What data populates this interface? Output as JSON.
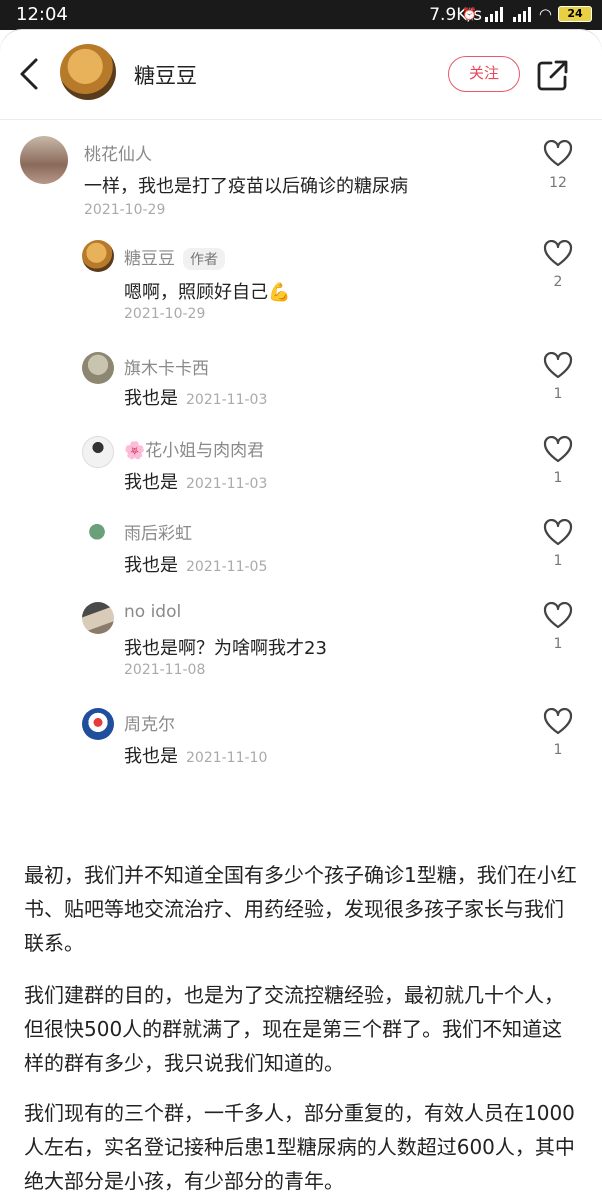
{
  "status_bar": {
    "time": "12:04",
    "speed": "7.9K/s",
    "battery": "24"
  },
  "header": {
    "title": "糖豆豆",
    "follow_label": "关注"
  },
  "comments": [
    {
      "name": "桃花仙人",
      "text": "一样，我也是打了疫苗以后确诊的糖尿病",
      "date": "2021-10-29",
      "likes": "12"
    },
    {
      "name": "糖豆豆",
      "tag": "作者",
      "text": "嗯啊，照顾好自己💪",
      "date": "2021-10-29",
      "likes": "2"
    },
    {
      "name": "旗木卡卡西",
      "text": "我也是",
      "date": "2021-11-03",
      "likes": "1"
    },
    {
      "name": "🌸花小姐与肉肉君",
      "text": "我也是",
      "date": "2021-11-03",
      "likes": "1"
    },
    {
      "name": "雨后彩虹",
      "text": "我也是",
      "date": "2021-11-05",
      "likes": "1"
    },
    {
      "name": "no idol",
      "text": "我也是啊？为啥啊我才23",
      "date": "2021-11-08",
      "likes": "1"
    },
    {
      "name": "周克尔",
      "text": "我也是",
      "date": "2021-11-10",
      "likes": "1"
    }
  ],
  "article": {
    "paragraphs": [
      "最初，我们并不知道全国有多少个孩子确诊1型糖，我们在小红书、贴吧等地交流治疗、用药经验，发现很多孩子家长与我们联系。",
      "我们建群的目的，也是为了交流控糖经验，最初就几十个人，但很快500人的群就满了，现在是第三个群了。我们不知道这样的群有多少，我只说我们知道的。",
      "我们现有的三个群，一千多人，部分重复的，有效人员在1000人左右，实名登记接种后患1型糖尿病的人数超过600人，其中绝大部分是小孩，有少部分的青年。"
    ]
  }
}
